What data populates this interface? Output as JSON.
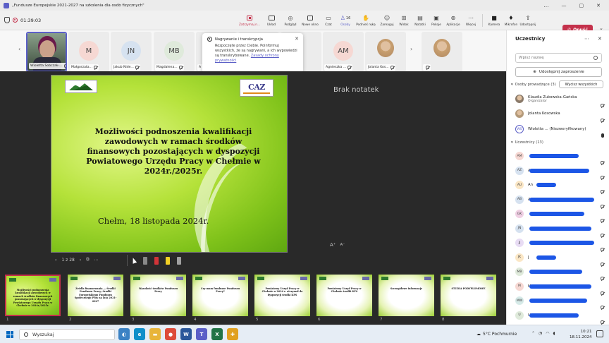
{
  "window": {
    "title": "„Fundusze Europejskie 2021-2027 na szkolenia dla osób fizycznych\"",
    "controls": [
      "…",
      "—",
      "▢",
      "✕"
    ]
  },
  "toolbar": {
    "timer": "01:39:03",
    "items": [
      {
        "id": "stop-recording",
        "label": "Zatrzymaj n...",
        "icon": "record-stop-icon"
      },
      {
        "id": "layout",
        "label": "Układ",
        "icon": "layout-icon"
      },
      {
        "id": "preview",
        "label": "Podgląd",
        "icon": "preview-icon"
      },
      {
        "id": "new-window",
        "label": "Nowe okno",
        "icon": "new-window-icon"
      },
      {
        "id": "chat",
        "label": "Czat",
        "icon": "chat-icon"
      },
      {
        "id": "people",
        "label": "Osoby",
        "icon": "people-icon",
        "badge": "16"
      },
      {
        "id": "raise-hand",
        "label": "Podnieś rękę",
        "icon": "hand-icon"
      },
      {
        "id": "react",
        "label": "Zareaguj",
        "icon": "smiley-icon"
      },
      {
        "id": "view",
        "label": "Widok",
        "icon": "grid-icon"
      },
      {
        "id": "notes",
        "label": "Notatki",
        "icon": "notes-icon"
      },
      {
        "id": "rooms",
        "label": "Pokoje",
        "icon": "rooms-icon"
      },
      {
        "id": "apps",
        "label": "Aplikacje",
        "icon": "plus-icon"
      },
      {
        "id": "more",
        "label": "Więcej",
        "icon": "more-icon"
      },
      {
        "id": "camera",
        "label": "Kamera",
        "icon": "camera-off-icon"
      },
      {
        "id": "mic",
        "label": "Mikrofon",
        "icon": "mic-off-icon"
      },
      {
        "id": "share",
        "label": "Udostępnij",
        "icon": "share-icon"
      }
    ],
    "leave_label": "Opuść"
  },
  "strip": {
    "tiles": [
      {
        "name": "Wioletta Sobczak-...",
        "initials": "",
        "color": "#6a8a6a",
        "photo": true,
        "speaking": true
      },
      {
        "name": "Małgorzata...",
        "initials": "M",
        "color": "#f6d8d3"
      },
      {
        "name": "Jakub Nide...",
        "initials": "JN",
        "color": "#d6e2f0"
      },
      {
        "name": "Magdalena...",
        "initials": "MB",
        "color": "#dfeadb"
      },
      {
        "name": "A",
        "initials": "",
        "color": "#ececec"
      },
      {
        "name": "",
        "initials": "",
        "color": "#ececec"
      },
      {
        "name": "",
        "initials": "",
        "color": "#ececec"
      },
      {
        "name": "Agnieszka ...",
        "initials": "AM",
        "color": "#f6d8d3"
      },
      {
        "name": "Jolanta Kos...",
        "initials": "",
        "color": "#e8e4dc",
        "photo": true
      },
      {
        "name": "",
        "initials": "",
        "color": "#e8e4dc",
        "photo": true
      }
    ]
  },
  "popup": {
    "title": "Nagrywanie i transkrypcja",
    "body": "Rozpoczęte przez Ciebie. Poinformuj wszystkich, że są nagrywani, a ich wypowiedzi są transkrybowane.",
    "link": "Zasady ochrony prywatności"
  },
  "slide": {
    "title": "Możliwości podnoszenia kwalifikacji zawodowych w ramach środków finansowych pozostających w dyspozycji Powiatowego Urzędu Pracy w Chełmie w 2024r./2025r.",
    "date": "Chełm, 18 listopada 2024r.",
    "logo_right_text": "CAZ"
  },
  "notes": "Brak notatek",
  "fontsize": {
    "increase": "A⁺",
    "decrease": "A⁻"
  },
  "slide_nav": {
    "counter": "1 z 28"
  },
  "thumbs": [
    {
      "num": "1",
      "text": "Możliwości podnoszenia kwalifikacji zawodowych w ramach środków finansowych pozostających w dyspozycji Powiatowego Urzędu Pracy w Chełmie w 2024r./2025r.",
      "green": true,
      "active": true
    },
    {
      "num": "2",
      "text": "Źródła finansowania — Środki Funduszu Pracy; Środki Europejskiego Funduszu Społecznego Plus na lata 2021-2027",
      "green": false
    },
    {
      "num": "3",
      "text": "Wysokość środków Funduszu Pracy",
      "green": false
    },
    {
      "num": "4",
      "text": "Czy mam fundusze Funduszu Pracy?",
      "green": false
    },
    {
      "num": "5",
      "text": "Powiatowy Urząd Pracy w Chełmie w 2024 r. otrzymał do dyspozycji środki KFS",
      "green": false
    },
    {
      "num": "6",
      "text": "Powiatowy Urząd Pracy w Chełmie środki KFS",
      "green": false
    },
    {
      "num": "7",
      "text": "Szczegółowe informacje",
      "green": false
    },
    {
      "num": "8",
      "text": "STUDIA PODYPLOMOWE",
      "green": false
    }
  ],
  "panel": {
    "title": "Uczestnicy",
    "search_placeholder": "Wpisz nazwę",
    "invite_label": "Udostępnij zaproszenie",
    "organizers_header": "Osoby prowadzące (3)",
    "mute_all_label": "Wycisz wszystkich",
    "organizers": [
      {
        "name": "Klaudia Żukowska-Gańska",
        "role": "Organizator",
        "initials": "",
        "color": "#8a7a6a",
        "photo": true
      },
      {
        "name": "Jolanta Kosowska",
        "role": "",
        "initials": "",
        "color": "#b49a7a",
        "photo": true
      },
      {
        "name": "Wioletta ... (Niezweryfikowany)",
        "role": "",
        "initials": "WS",
        "color": "#ffffff"
      }
    ],
    "attendees_header": "Uczestnicy (13)",
    "attendees": [
      {
        "initials": "AM",
        "color": "#f6d8d3",
        "text": ""
      },
      {
        "initials": "AZ",
        "color": "#d6e2f0",
        "text": "A"
      },
      {
        "initials": "AU",
        "color": "#fbe7c6",
        "text": "An"
      },
      {
        "initials": "AB",
        "color": "#d6e2f0",
        "text": "A"
      },
      {
        "initials": "GK",
        "color": "#f0d0e4",
        "text": ""
      },
      {
        "initials": "JN",
        "color": "#d6e2f0",
        "text": ""
      },
      {
        "initials": "JJ",
        "color": "#e8dcf4",
        "text": ""
      },
      {
        "initials": "JK",
        "color": "#fbe7c6",
        "text": "J"
      },
      {
        "initials": "MB",
        "color": "#dfeadb",
        "text": ""
      },
      {
        "initials": "M",
        "color": "#f6d8d3",
        "text": "M"
      },
      {
        "initials": "MW",
        "color": "#d6eae8",
        "text": ""
      },
      {
        "initials": "U",
        "color": "#dfeadb",
        "text": "U"
      }
    ]
  },
  "taskbar": {
    "search_placeholder": "Wyszukaj",
    "weather": "5°C  Pochmurnie",
    "time": "10:21",
    "date": "18.11.2024",
    "apps": [
      {
        "icon": "copilot-icon",
        "color": "#3b82c4",
        "glyph": "◐"
      },
      {
        "icon": "edge-icon",
        "color": "#0f8fc9",
        "glyph": "e"
      },
      {
        "icon": "file-explorer-icon",
        "color": "#e8b53a",
        "glyph": "▬"
      },
      {
        "icon": "chrome-icon",
        "color": "#dd4b39",
        "glyph": "●"
      },
      {
        "icon": "word-icon",
        "color": "#2b579a",
        "glyph": "W"
      },
      {
        "icon": "teams-icon",
        "color": "#5b5fc7",
        "glyph": "T"
      },
      {
        "icon": "excel-icon",
        "color": "#217346",
        "glyph": "X"
      },
      {
        "icon": "app-icon",
        "color": "#e0a020",
        "glyph": "✚"
      }
    ]
  }
}
